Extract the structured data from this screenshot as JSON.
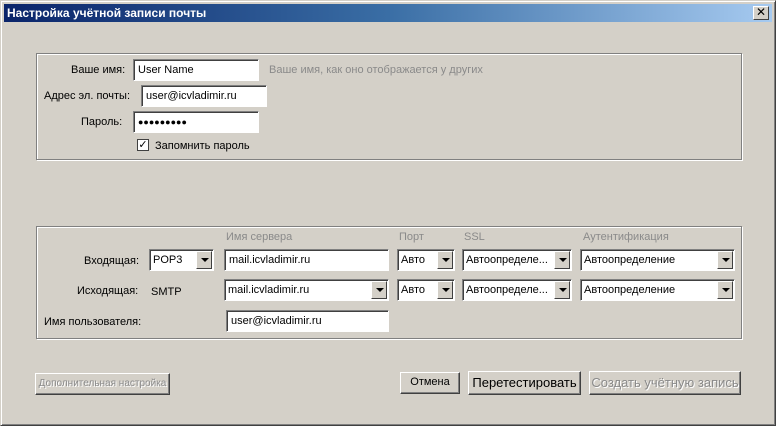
{
  "window": {
    "title": "Настройка учётной записи почты",
    "close_glyph": "✕"
  },
  "identity": {
    "name_label": "Ваше имя:",
    "name_value": "User Name",
    "name_hint": "Ваше имя, как оно отображается у других",
    "email_label": "Адрес эл. почты:",
    "email_value": "user@icvladimir.ru",
    "password_label": "Пароль:",
    "password_value": "●●●●●●●●●",
    "remember_label": "Запомнить пароль",
    "remember_checked": true,
    "check_glyph": "✓"
  },
  "server": {
    "headers": {
      "server_name": "Имя сервера",
      "port": "Порт",
      "ssl": "SSL",
      "auth": "Аутентификация"
    },
    "incoming": {
      "label": "Входящая:",
      "protocol": "POP3",
      "server": "mail.icvladimir.ru",
      "port": "Авто",
      "ssl": "Автоопределе...",
      "auth": "Автоопределение"
    },
    "outgoing": {
      "label": "Исходящая:",
      "protocol": "SMTP",
      "server": "mail.icvladimir.ru",
      "port": "Авто",
      "ssl": "Автоопределе...",
      "auth": "Автоопределение"
    },
    "username_label": "Имя пользователя:",
    "username_value": "user@icvladimir.ru"
  },
  "buttons": {
    "advanced": "Дополнительная настройка",
    "cancel": "Отмена",
    "retest": "Перетестировать",
    "create": "Создать учётную запись"
  }
}
